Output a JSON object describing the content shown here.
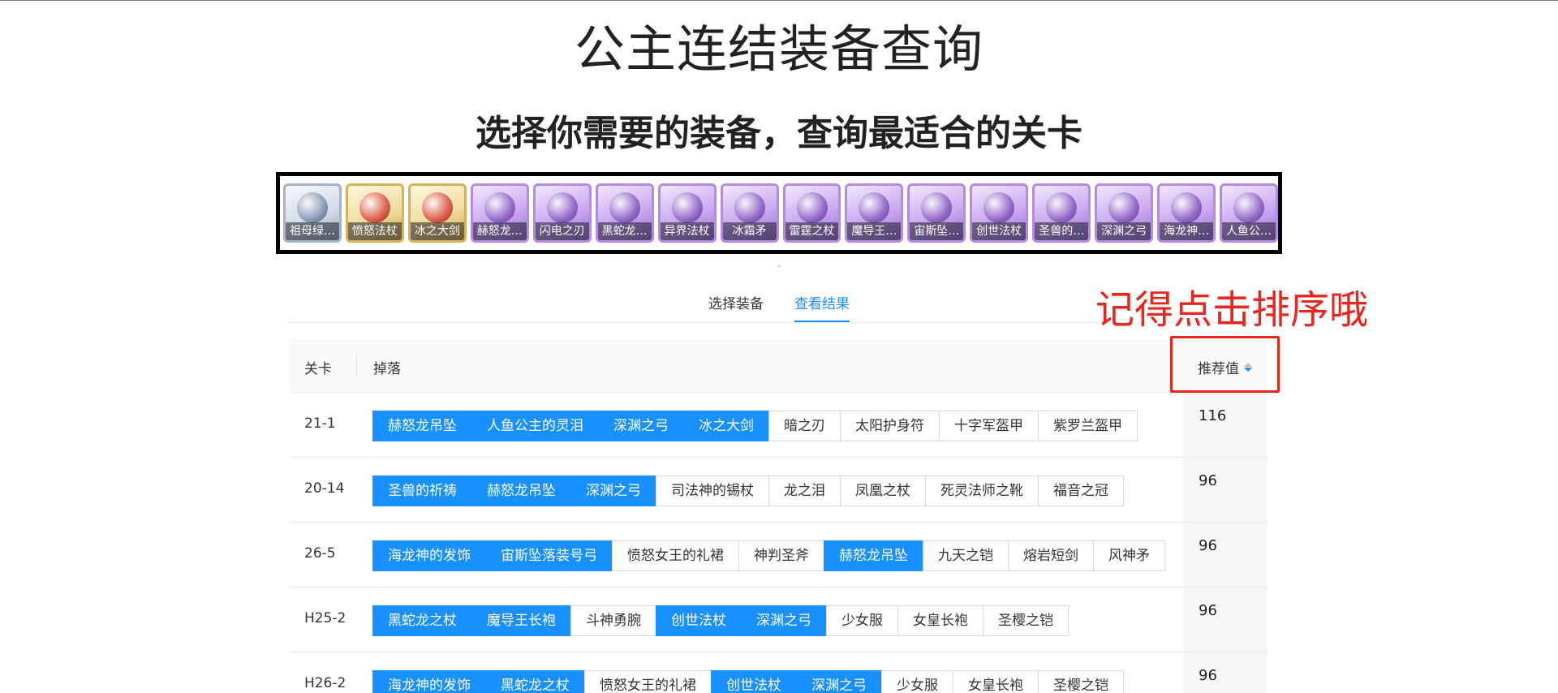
{
  "header": {
    "title": "公主连结装备查询",
    "subtitle": "选择你需要的装备，查询最适合的关卡"
  },
  "equipment_strip": [
    {
      "name": "祖母绿…",
      "rarity": "silver"
    },
    {
      "name": "愤怒法杖",
      "rarity": "gold"
    },
    {
      "name": "冰之大剑",
      "rarity": "gold"
    },
    {
      "name": "赫怒龙…",
      "rarity": "purple"
    },
    {
      "name": "闪电之刃",
      "rarity": "purple"
    },
    {
      "name": "黑蛇龙…",
      "rarity": "purple"
    },
    {
      "name": "异界法杖",
      "rarity": "purple"
    },
    {
      "name": "冰霜矛",
      "rarity": "purple"
    },
    {
      "name": "雷霆之杖",
      "rarity": "purple"
    },
    {
      "name": "魔导王…",
      "rarity": "purple"
    },
    {
      "name": "宙斯坠…",
      "rarity": "purple"
    },
    {
      "name": "创世法杖",
      "rarity": "purple"
    },
    {
      "name": "圣兽的…",
      "rarity": "purple"
    },
    {
      "name": "深渊之弓",
      "rarity": "purple"
    },
    {
      "name": "海龙神…",
      "rarity": "purple"
    },
    {
      "name": "人鱼公…",
      "rarity": "purple"
    }
  ],
  "tabs": [
    {
      "label": "选择装备",
      "active": false
    },
    {
      "label": "查看结果",
      "active": true
    }
  ],
  "annotation": {
    "text": "记得点击排序哦",
    "color": "#e8261d"
  },
  "table": {
    "columns": {
      "stage": "关卡",
      "drops": "掉落",
      "score": "推荐值"
    },
    "rows": [
      {
        "stage": "21-1",
        "score": "116",
        "drops": [
          {
            "name": "赫怒龙吊坠",
            "hit": true
          },
          {
            "name": "人鱼公主的灵泪",
            "hit": true
          },
          {
            "name": "深渊之弓",
            "hit": true
          },
          {
            "name": "冰之大剑",
            "hit": true
          },
          {
            "name": "暗之刃",
            "hit": false
          },
          {
            "name": "太阳护身符",
            "hit": false
          },
          {
            "name": "十字军盔甲",
            "hit": false
          },
          {
            "name": "紫罗兰盔甲",
            "hit": false
          }
        ]
      },
      {
        "stage": "20-14",
        "score": "96",
        "drops": [
          {
            "name": "圣兽的祈祷",
            "hit": true
          },
          {
            "name": "赫怒龙吊坠",
            "hit": true
          },
          {
            "name": "深渊之弓",
            "hit": true
          },
          {
            "name": "司法神的锡杖",
            "hit": false
          },
          {
            "name": "龙之泪",
            "hit": false
          },
          {
            "name": "凤凰之杖",
            "hit": false
          },
          {
            "name": "死灵法师之靴",
            "hit": false
          },
          {
            "name": "福音之冠",
            "hit": false
          }
        ]
      },
      {
        "stage": "26-5",
        "score": "96",
        "drops": [
          {
            "name": "海龙神的发饰",
            "hit": true
          },
          {
            "name": "宙斯坠落装号弓",
            "hit": true
          },
          {
            "name": "愤怒女王的礼裙",
            "hit": false
          },
          {
            "name": "神判圣斧",
            "hit": false
          },
          {
            "name": "赫怒龙吊坠",
            "hit": true
          },
          {
            "name": "九天之铠",
            "hit": false
          },
          {
            "name": "熔岩短剑",
            "hit": false
          },
          {
            "name": "风神矛",
            "hit": false
          }
        ]
      },
      {
        "stage": "H25-2",
        "score": "96",
        "drops": [
          {
            "name": "黑蛇龙之杖",
            "hit": true
          },
          {
            "name": "魔导王长袍",
            "hit": true
          },
          {
            "name": "斗神勇腕",
            "hit": false
          },
          {
            "name": "创世法杖",
            "hit": true
          },
          {
            "name": "深渊之弓",
            "hit": true
          },
          {
            "name": "少女服",
            "hit": false
          },
          {
            "name": "女皇长袍",
            "hit": false
          },
          {
            "name": "圣樱之铠",
            "hit": false
          }
        ]
      },
      {
        "stage": "H26-2",
        "score": "96",
        "drops": [
          {
            "name": "海龙神的发饰",
            "hit": true
          },
          {
            "name": "黑蛇龙之杖",
            "hit": true
          },
          {
            "name": "愤怒女王的礼裙",
            "hit": false
          },
          {
            "name": "创世法杖",
            "hit": true
          },
          {
            "name": "深渊之弓",
            "hit": true
          },
          {
            "name": "少女服",
            "hit": false
          },
          {
            "name": "女皇长袍",
            "hit": false
          },
          {
            "name": "圣樱之铠",
            "hit": false
          }
        ]
      }
    ]
  },
  "colors": {
    "accent": "#1890ff",
    "annotation": "#e8261d"
  }
}
